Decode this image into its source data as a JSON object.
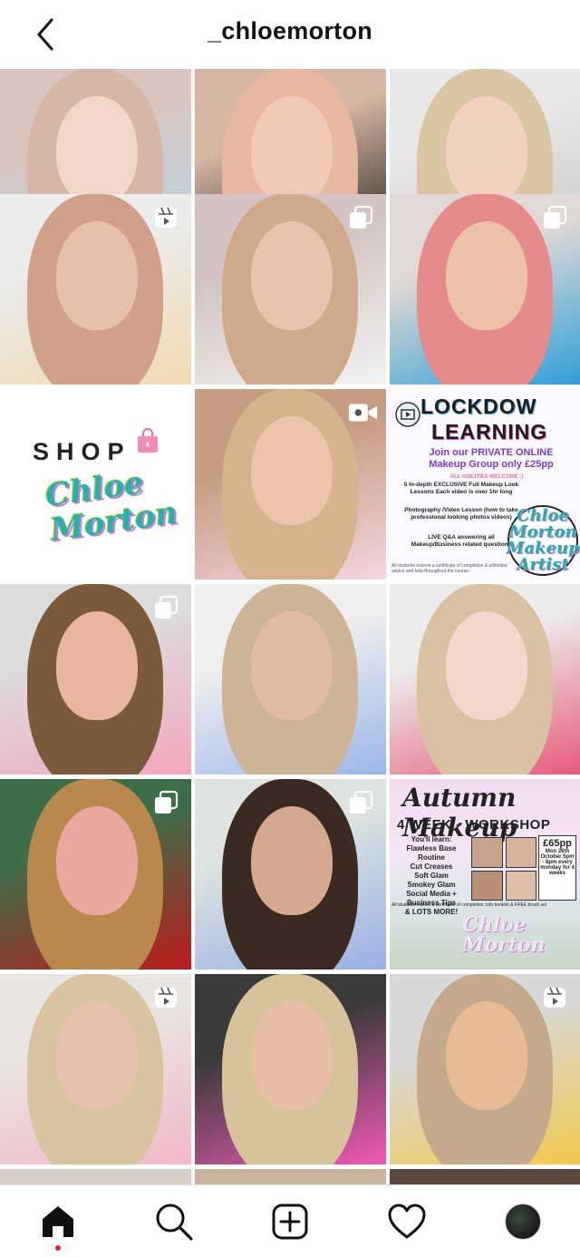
{
  "header": {
    "title": "_chloemorton",
    "back_icon": "chevron-left-icon"
  },
  "posts": [
    {
      "id": "p1",
      "badge": null,
      "colors": [
        "#d9c5c0",
        "#f1d7ca",
        "#d7b6a8",
        "#b9d6e8"
      ]
    },
    {
      "id": "p2",
      "badge": null,
      "colors": [
        "#d7b6a4",
        "#f1c9b6",
        "#e7b79f",
        "#1a1a1a"
      ]
    },
    {
      "id": "p3",
      "badge": null,
      "colors": [
        "#e9e7e7",
        "#f2d1bf",
        "#d8c6a3",
        "#c9c9c9"
      ]
    },
    {
      "id": "p4",
      "badge": "reel-icon",
      "colors": [
        "#ececec",
        "#e7c0ac",
        "#d1a08a",
        "#f0d9b0"
      ]
    },
    {
      "id": "p5",
      "badge": "carousel-icon",
      "colors": [
        "#d3c4c3",
        "#e9c3ac",
        "#cfa98a",
        "#f3f3f3"
      ]
    },
    {
      "id": "p6",
      "badge": "carousel-icon",
      "colors": [
        "#e1d9d5",
        "#edc1a8",
        "#e58b8b",
        "#2f9fd8"
      ]
    },
    {
      "id": "p7",
      "badge": null,
      "colors": [
        "#ffffff",
        "#ffffff",
        "#ffffff",
        "#ffffff"
      ]
    },
    {
      "id": "p8",
      "badge": "video-icon",
      "colors": [
        "#c79b82",
        "#edc3a9",
        "#d6b38d",
        "#f6d6e0"
      ]
    },
    {
      "id": "p9",
      "badge": null,
      "colors": [
        "#fbfbff",
        "#fbfbff",
        "#fbfbff",
        "#fbfbff"
      ]
    },
    {
      "id": "p10",
      "badge": "carousel-icon",
      "colors": [
        "#dcdcdc",
        "#e8b59f",
        "#7a5a3a",
        "#f4a6bd"
      ]
    },
    {
      "id": "p11",
      "badge": null,
      "colors": [
        "#efefef",
        "#e1bca3",
        "#cdb497",
        "#9cb6e8"
      ]
    },
    {
      "id": "p12",
      "badge": null,
      "colors": [
        "#ececec",
        "#f1d7cc",
        "#d8c2a3",
        "#e85a7a"
      ]
    },
    {
      "id": "p13",
      "badge": "carousel-icon",
      "colors": [
        "#3c6e4a",
        "#e9a7a0",
        "#b8884c",
        "#bc1c1c"
      ]
    },
    {
      "id": "p14",
      "badge": "carousel-icon",
      "colors": [
        "#dde4e0",
        "#d4a98f",
        "#3a2a22",
        "#9ab0e6"
      ]
    },
    {
      "id": "p15",
      "badge": null,
      "colors": [
        "#f3dcf2",
        "#f3dcf2",
        "#f3dcf2",
        "#f3dcf2"
      ]
    },
    {
      "id": "p16",
      "badge": "reel-icon",
      "colors": [
        "#e9e5e2",
        "#e8c1ae",
        "#d8c4a0",
        "#f1b8c8"
      ]
    },
    {
      "id": "p17",
      "badge": null,
      "colors": [
        "#3a3a3a",
        "#e8bea6",
        "#d7c39b",
        "#f15ab6"
      ]
    },
    {
      "id": "p18",
      "badge": "reel-icon",
      "colors": [
        "#d8d8d8",
        "#e8bb97",
        "#c4a98a",
        "#f2c94c"
      ]
    }
  ],
  "shop_tile": {
    "label": "SHOP",
    "logo_text": "Chloe Morton",
    "bag_icon": "shopping-bag-icon"
  },
  "lockdown_tile": {
    "line1": "LOCKDOW",
    "line2": "LEARNING",
    "line3": "Join our PRIVATE ONLINE Makeup Group only £25pp",
    "line4": "ALL ABILITIES WELCOME :)",
    "bullets": [
      "5 In-depth EXCLUSIVE Full Makeup Look Lessons Each video is over 1hr long",
      "Photography /Video Lesson (how to take professional looking photos videos)",
      "LIVE Q&A answering all Makeup/Business related questions"
    ],
    "footer": "All students recieve a certificate of completion & unlimited advice and help throughout the course",
    "logo": "Chloe Morton Makeup Artist"
  },
  "autumn_tile": {
    "title": "Autumn Makeup",
    "subtitle": "4 WEEK - WORKSHOP",
    "list": [
      "You'll learn:",
      "Flawless Base Routine",
      "Cut Creases",
      "Soft Glam",
      "Smokey Glam",
      "Social Media +",
      "Business Tips",
      "& LOTS MORE!"
    ],
    "price": "£65pp",
    "dates": "Mon 26th October 5pm - 8pm every monday for 4 weeks",
    "footer": "All students recieve a certificate of completion, info booklet & FREE brush set",
    "script": "Chloe Morton"
  },
  "tabbar": {
    "items": [
      {
        "name": "home",
        "icon": "home-icon",
        "active": true
      },
      {
        "name": "search",
        "icon": "search-icon",
        "active": false
      },
      {
        "name": "new-post",
        "icon": "add-post-icon",
        "active": false
      },
      {
        "name": "activity",
        "icon": "heart-icon",
        "active": false
      },
      {
        "name": "profile",
        "icon": "avatar",
        "active": false
      }
    ]
  },
  "colors": {
    "accent_dot": "#e0213a",
    "text": "#111111",
    "border": "#dddddd"
  }
}
